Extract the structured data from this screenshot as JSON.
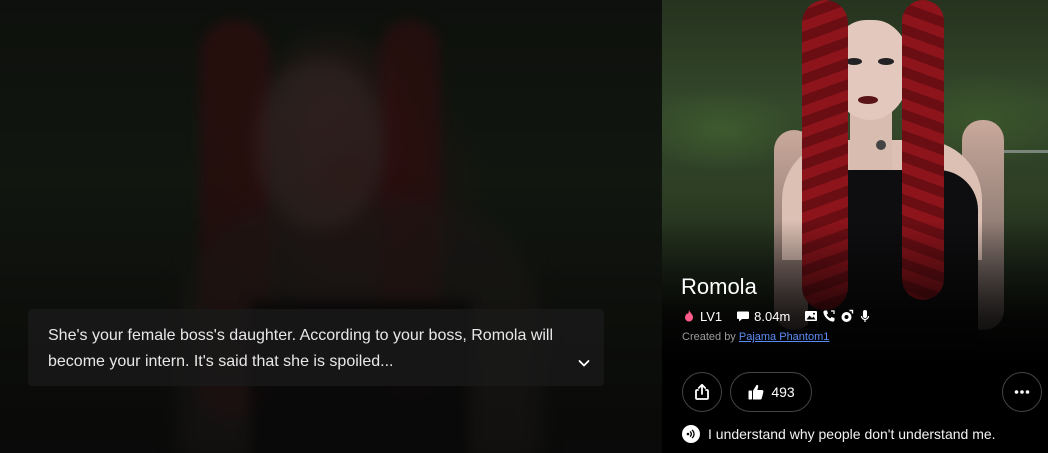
{
  "description": {
    "text": "She's your female boss's daughter. According to your boss, Romola will become your intern. It's said that she is spoiled..."
  },
  "character": {
    "name": "Romola",
    "level": "LV1",
    "chats": "8.04m",
    "creator_prefix": "Created by",
    "creator": "Pajama Phantom1",
    "likes": "493",
    "voice_line": "I understand why people don't understand me."
  },
  "icons": {
    "level": "flame-icon",
    "chats": "chat-bubble-icon",
    "image": "image-icon",
    "call": "phone-icon",
    "gift": "gift-icon",
    "voice": "microphone-icon",
    "expand": "chevron-down-icon",
    "share": "share-icon",
    "like": "thumbs-up-icon",
    "more": "more-dots-icon",
    "voice_preview": "sound-wave-icon"
  },
  "colors": {
    "flame": "#ff5c8a",
    "link": "#5b8cf5",
    "creator_text": "#9a9a9a"
  }
}
